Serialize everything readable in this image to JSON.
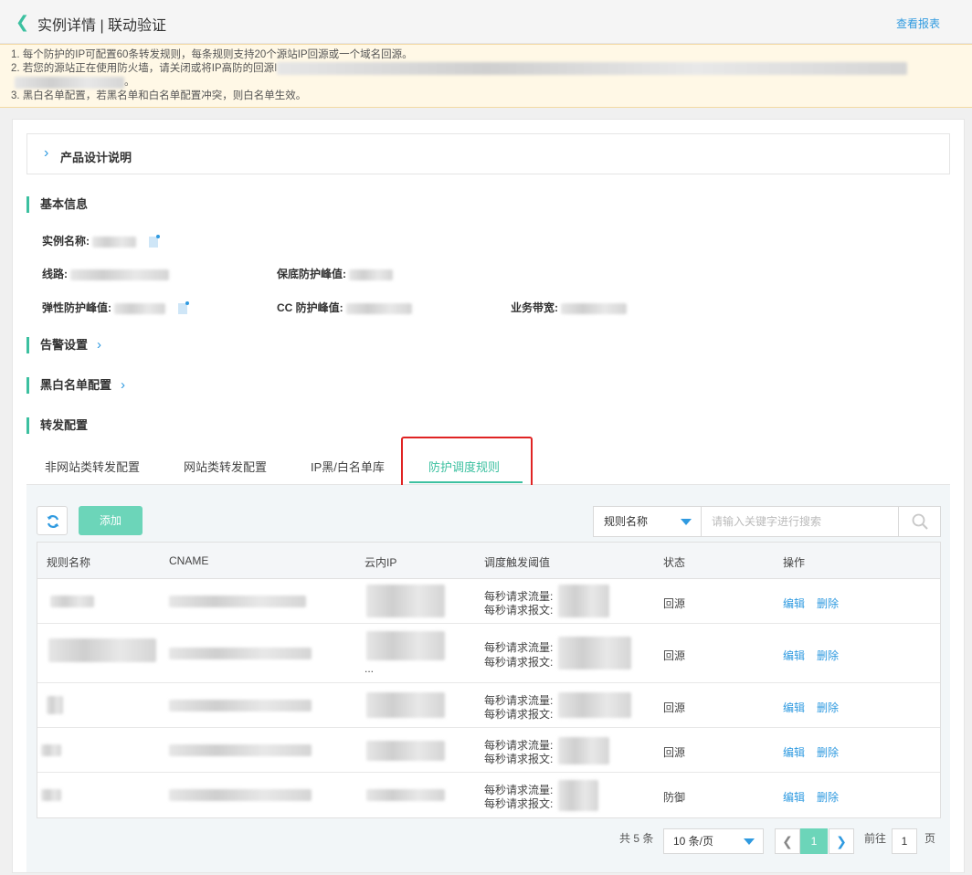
{
  "header": {
    "title": "实例详情 | 联动验证",
    "report_link": "查看报表"
  },
  "notice": {
    "line1": "1. 每个防护的IP可配置60条转发规则，每条规则支持20个源站IP回源或一个域名回源。",
    "line2": "2. 若您的源站正在使用防火墙，请关闭或将IP高防的回源I",
    "line2b": "。",
    "line3": "3. 黑白名单配置，若黑名单和白名单配置冲突，则白名单生效。"
  },
  "collapse": {
    "label": "产品设计说明"
  },
  "basic": {
    "title": "基本信息",
    "instance_name_label": "实例名称:",
    "line_label": "线路:",
    "base_peak_label": "保底防护峰值:",
    "elastic_peak_label": "弹性防护峰值:",
    "cc_peak_label": "CC 防护峰值:",
    "bandwidth_label": "业务带宽:"
  },
  "alarm": {
    "title": "告警设置"
  },
  "blackwhite": {
    "title": "黑白名单配置"
  },
  "forward": {
    "title": "转发配置"
  },
  "tabs": [
    {
      "label": "非网站类转发配置"
    },
    {
      "label": "网站类转发配置"
    },
    {
      "label": "IP黑/白名单库"
    },
    {
      "label": "防护调度规则"
    }
  ],
  "toolbar": {
    "add_label": "添加",
    "search_field": "规则名称",
    "search_placeholder": "请输入关键字进行搜索"
  },
  "table": {
    "headers": [
      "规则名称",
      "CNAME",
      "云内IP",
      "调度触发阈值",
      "状态",
      "操作"
    ],
    "threshold_line1": "每秒请求流量:",
    "threshold_line2": "每秒请求报文:",
    "edit_label": "编辑",
    "delete_label": "删除",
    "rows": [
      {
        "status": "回源",
        "ip_extra": ""
      },
      {
        "status": "回源",
        "ip_extra": "..."
      },
      {
        "status": "回源",
        "ip_extra": ""
      },
      {
        "status": "回源",
        "ip_extra": ""
      },
      {
        "status": "防御",
        "ip_extra": ""
      }
    ]
  },
  "pagination": {
    "total": "共 5 条",
    "page_size": "10 条/页",
    "current_page": "1",
    "goto_label": "前往",
    "goto_value": "1",
    "page_unit": "页"
  }
}
